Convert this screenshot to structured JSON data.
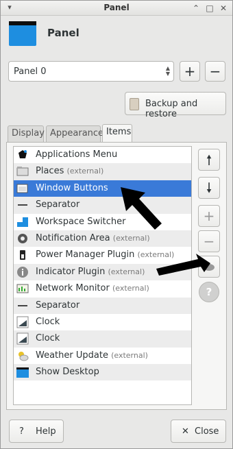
{
  "window": {
    "title": "Panel",
    "header_title": "Panel"
  },
  "panel_selector": {
    "value": "Panel 0"
  },
  "buttons": {
    "backup_restore": "Backup and restore",
    "help": "Help",
    "close": "Close"
  },
  "tabs": [
    {
      "label": "Display"
    },
    {
      "label": "Appearance"
    },
    {
      "label": "Items",
      "active": true
    }
  ],
  "items": [
    {
      "name": "Applications Menu",
      "ext": ""
    },
    {
      "name": "Places",
      "ext": "(external)"
    },
    {
      "name": "Window Buttons",
      "ext": "",
      "selected": true
    },
    {
      "name": "Separator",
      "ext": ""
    },
    {
      "name": "Workspace Switcher",
      "ext": ""
    },
    {
      "name": "Notification Area",
      "ext": "(external)"
    },
    {
      "name": "Power Manager Plugin",
      "ext": "(external)"
    },
    {
      "name": "Indicator Plugin",
      "ext": "(external)"
    },
    {
      "name": "Network Monitor",
      "ext": "(external)"
    },
    {
      "name": "Separator",
      "ext": ""
    },
    {
      "name": "Clock",
      "ext": ""
    },
    {
      "name": "Clock",
      "ext": ""
    },
    {
      "name": "Weather Update",
      "ext": "(external)"
    },
    {
      "name": "Show Desktop",
      "ext": ""
    }
  ],
  "colors": {
    "selection": "#3a7ad8",
    "panel_icon": "#1e8ee0"
  }
}
